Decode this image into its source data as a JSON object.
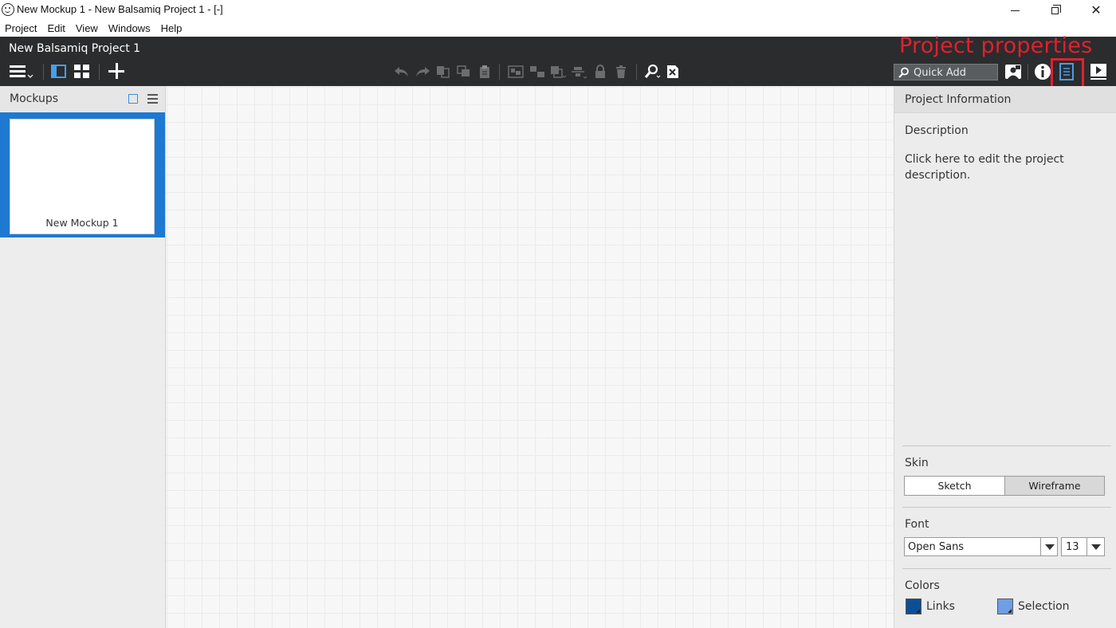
{
  "window": {
    "title": "New Mockup 1 - New Balsamiq Project 1 - [-]",
    "close_glyph": "✕"
  },
  "menubar": {
    "items": [
      "Project",
      "Edit",
      "View",
      "Windows",
      "Help"
    ]
  },
  "header": {
    "project_title": "New Balsamiq Project 1",
    "annotation": "Project properties",
    "quick_add_placeholder": "Quick Add"
  },
  "toolbar": {
    "icons": [
      "hamburger-menu-icon",
      "single-pane-layout-icon",
      "grid-layout-icon",
      "add-icon",
      "undo-icon",
      "redo-icon",
      "copy-icon",
      "duplicate-icon",
      "paste-icon",
      "group-icon",
      "ungroup-icon",
      "arrange-icon",
      "align-icon",
      "lock-icon",
      "delete-icon",
      "search-icon",
      "close-search-icon",
      "search-icon",
      "account-icon",
      "info-icon",
      "project-properties-icon",
      "presentation-icon"
    ],
    "accent_color": "#4a9de6",
    "highlight_color": "#e3202d"
  },
  "left_panel": {
    "header": "Mockups",
    "mockups": [
      {
        "label": "New Mockup 1"
      }
    ],
    "selected_color": "#1e79d2"
  },
  "right_panel": {
    "header": "Project Information",
    "description_label": "Description",
    "description_text": "Click here to edit the project description.",
    "skin_label": "Skin",
    "skin_options": [
      "Sketch",
      "Wireframe"
    ],
    "skin_selected": "Wireframe",
    "font_label": "Font",
    "font_value": "Open Sans",
    "font_size_value": "13",
    "colors_label": "Colors",
    "links_label": "Links",
    "links_color": "#0b4f94",
    "selection_label": "Selection",
    "selection_color": "#6f9ee3"
  }
}
